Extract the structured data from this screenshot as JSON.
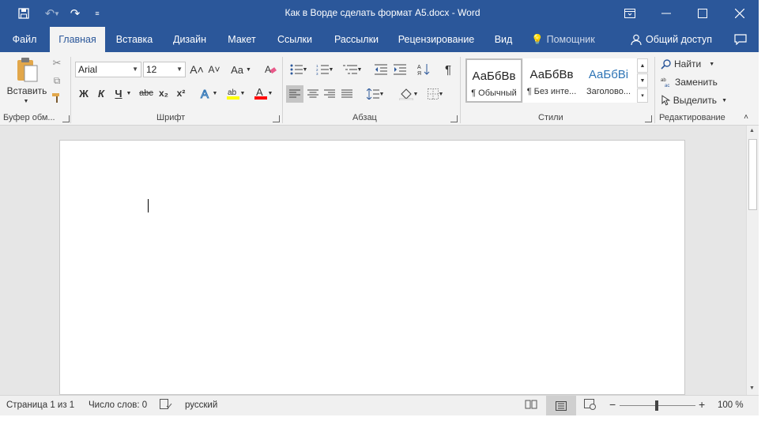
{
  "window": {
    "title": "Как в Ворде сделать формат А5.docx - Word"
  },
  "tabs": [
    {
      "label": "Файл"
    },
    {
      "label": "Главная"
    },
    {
      "label": "Вставка"
    },
    {
      "label": "Дизайн"
    },
    {
      "label": "Макет"
    },
    {
      "label": "Ссылки"
    },
    {
      "label": "Рассылки"
    },
    {
      "label": "Рецензирование"
    },
    {
      "label": "Вид"
    }
  ],
  "assistant": {
    "label": "Помощник"
  },
  "share": {
    "label": "Общий доступ"
  },
  "clipboard": {
    "paste_label": "Вставить",
    "group_label": "Буфер обм..."
  },
  "font": {
    "name": "Arial",
    "size": "12",
    "group_label": "Шрифт",
    "bold": "Ж",
    "italic": "К",
    "underline": "Ч",
    "strike": "abc",
    "subscript": "x₂",
    "superscript": "x²",
    "grow": "A˄",
    "shrink": "A˅",
    "case": "Aa"
  },
  "paragraph": {
    "group_label": "Абзац"
  },
  "styles": {
    "group_label": "Стили",
    "items": [
      {
        "preview": "АаБбВв",
        "name": "¶ Обычный"
      },
      {
        "preview": "АаБбВв",
        "name": "¶ Без инте..."
      },
      {
        "preview": "АаБбВі",
        "name": "Заголово..."
      }
    ],
    "heading_color": "#2e74b5"
  },
  "editing": {
    "group_label": "Редактирование",
    "find": "Найти",
    "replace": "Заменить",
    "select": "Выделить"
  },
  "status": {
    "page": "Страница 1 из 1",
    "words": "Число слов: 0",
    "language": "русский",
    "zoom": "100 %"
  },
  "colors": {
    "accent": "#2b579a",
    "highlight": "#ffff00",
    "font_color": "#ff0000"
  }
}
